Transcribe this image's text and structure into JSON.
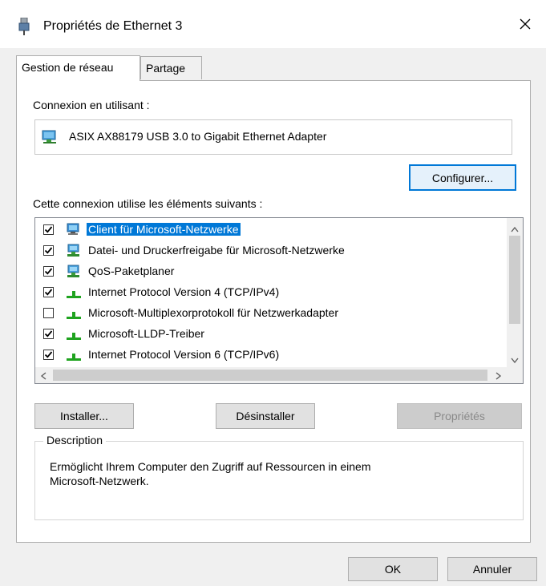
{
  "window": {
    "title": "Propriétés de Ethernet 3",
    "close_glyph": "✕"
  },
  "tabs": [
    {
      "label": "Gestion de réseau",
      "active": true
    },
    {
      "label": "Partage",
      "active": false
    }
  ],
  "connection": {
    "label": "Connexion en utilisant :",
    "adapter": "ASIX AX88179 USB 3.0 to Gigabit Ethernet Adapter",
    "configure_button": "Configurer..."
  },
  "items_section": {
    "label": "Cette connexion utilise les éléments suivants :",
    "items": [
      {
        "label": "Client für Microsoft-Netzwerke",
        "checked": true,
        "selected": true,
        "icon": "network-client-icon"
      },
      {
        "label": "Datei- und Druckerfreigabe für Microsoft-Netzwerke",
        "checked": true,
        "selected": false,
        "icon": "network-service-icon"
      },
      {
        "label": "QoS-Paketplaner",
        "checked": true,
        "selected": false,
        "icon": "network-service-icon"
      },
      {
        "label": "Internet Protocol Version 4 (TCP/IPv4)",
        "checked": true,
        "selected": false,
        "icon": "protocol-icon"
      },
      {
        "label": "Microsoft-Multiplexorprotokoll für Netzwerkadapter",
        "checked": false,
        "selected": false,
        "icon": "protocol-icon"
      },
      {
        "label": "Microsoft-LLDP-Treiber",
        "checked": true,
        "selected": false,
        "icon": "protocol-icon"
      },
      {
        "label": "Internet Protocol Version 6 (TCP/IPv6)",
        "checked": true,
        "selected": false,
        "icon": "protocol-icon"
      }
    ]
  },
  "actions": {
    "install": "Installer...",
    "uninstall": "Désinstaller",
    "properties": "Propriétés"
  },
  "description": {
    "legend": "Description",
    "text_line1": "Ermöglicht Ihrem Computer den Zugriff auf Ressourcen in einem",
    "text_line2": "Microsoft-Netzwerk."
  },
  "footer": {
    "ok": "OK",
    "cancel": "Annuler"
  },
  "colors": {
    "selection": "#0078d7",
    "focus_border": "#0078d7",
    "protocol_green": "#1fa31f"
  }
}
